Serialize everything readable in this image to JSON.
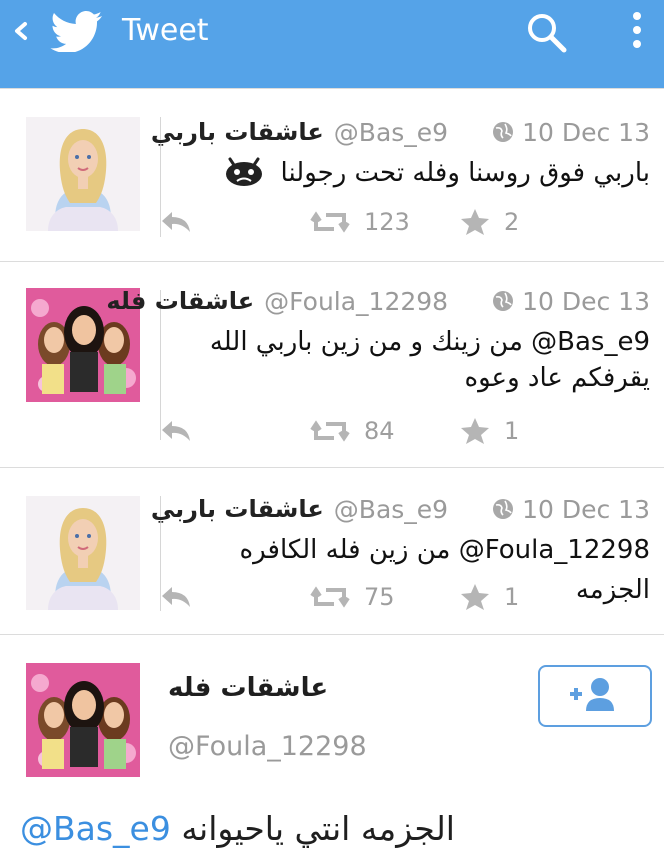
{
  "header": {
    "title": "Tweet",
    "back_icon": "chevron-left-icon",
    "logo_icon": "twitter-bird-icon",
    "search_icon": "search-icon",
    "menu_icon": "more-vertical-icon",
    "color": "#55a3e8"
  },
  "tweets": [
    {
      "name": "عاشقات باربي",
      "handle": "@Bas_e9",
      "date": "10 Dec 13",
      "text": "باربي فوق روسنا وفله تحت رجولنا",
      "emoji_icon": "crying-face-icon",
      "retweets": "123",
      "favorites": "2",
      "avatar": "barbie-doll-avatar"
    },
    {
      "name": "عاشقات فله",
      "handle": "@Foula_12298",
      "date": "10 Dec 13",
      "mention": "@Bas_e9",
      "text_line1": "من زينك و من زين باربي الله",
      "text_line2": "يقرفكم عاد وعوه",
      "retweets": "84",
      "favorites": "1",
      "avatar": "fulla-dolls-avatar"
    },
    {
      "name": "عاشقات باربي",
      "handle": "@Bas_e9",
      "date": "10 Dec 13",
      "mention": "@Foula_12298",
      "text": "من زين فله الكافره الجزمه",
      "retweets": "75",
      "favorites": "1",
      "avatar": "barbie-doll-avatar"
    }
  ],
  "profile": {
    "name": "عاشقات فله",
    "handle": "@Foula_12298",
    "follow_icon": "add-user-icon",
    "mention": "@Bas_e9",
    "text": "الجزمه انتي ياحيوانه",
    "mention_color": "#3b8fe0"
  }
}
